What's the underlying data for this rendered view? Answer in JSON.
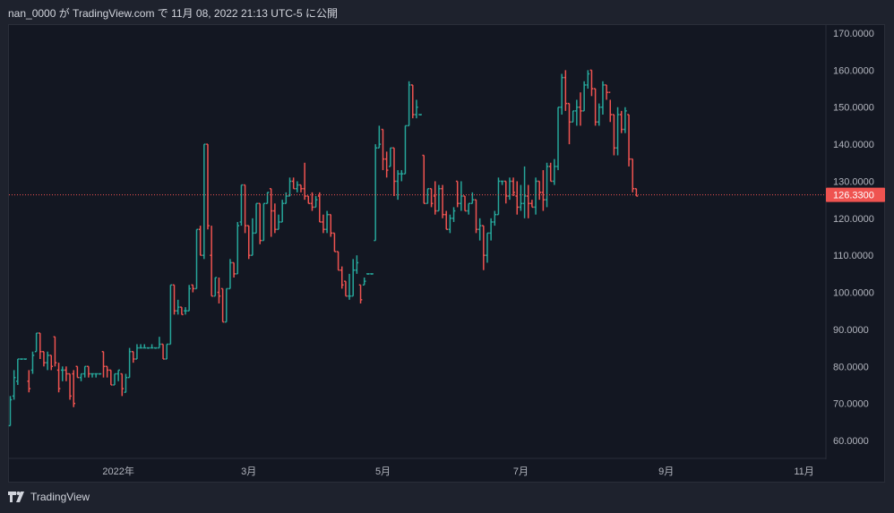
{
  "header": {
    "publish_text": "nan_0000 が TradingView.com で 11月 08, 2022 21:13 UTC-5 に公開"
  },
  "footer": {
    "brand_text": "TradingView",
    "logo_icon": "tradingview-logo-icon"
  },
  "colors": {
    "background": "#131722",
    "outer_background": "#1e222d",
    "up": "#26a69a",
    "down": "#ef5350",
    "text": "#d1d4dc",
    "axis_text": "#b2b5be",
    "price_line": "#ef5350"
  },
  "chart_data": {
    "type": "ohlc",
    "title": "",
    "xlabel": "",
    "ylabel": "",
    "ylim": [
      55,
      172
    ],
    "y_ticks": [
      "60.0000",
      "70.0000",
      "80.0000",
      "90.0000",
      "100.0000",
      "110.0000",
      "120.0000",
      "130.0000",
      "140.0000",
      "150.0000",
      "160.0000",
      "170.0000"
    ],
    "y_tick_values": [
      60,
      70,
      80,
      90,
      100,
      110,
      120,
      130,
      140,
      150,
      160,
      170
    ],
    "x_ticks": [
      "2022年",
      "3月",
      "5月",
      "7月",
      "9月",
      "11月"
    ],
    "x_tick_bar_index": [
      29,
      64,
      100,
      137,
      176,
      213
    ],
    "last_price": 126.33,
    "last_price_label": "126.3300",
    "series": [
      {
        "bars": [
          [
            64,
            72,
            64,
            71
          ],
          [
            72,
            79,
            71,
            77
          ],
          [
            76,
            82,
            75,
            82
          ],
          [
            82,
            82,
            82,
            82
          ],
          [
            82,
            82,
            82,
            82
          ],
          [
            76,
            79,
            73,
            74
          ],
          [
            79,
            84,
            78,
            83
          ],
          [
            84,
            89,
            84,
            89
          ],
          [
            89,
            89,
            82,
            84
          ],
          [
            84,
            84,
            80,
            81
          ],
          [
            81,
            84,
            79,
            83
          ],
          [
            83,
            83,
            79,
            80
          ],
          [
            88,
            88,
            80,
            81
          ],
          [
            79,
            81,
            73,
            74
          ],
          [
            79,
            80,
            76,
            79
          ],
          [
            79,
            80,
            76,
            78
          ],
          [
            78,
            78,
            71,
            72
          ],
          [
            78,
            79,
            69,
            70
          ],
          [
            80,
            80,
            77,
            77
          ],
          [
            77,
            78,
            76,
            78
          ],
          [
            78,
            80,
            77,
            80
          ],
          [
            80,
            80,
            77,
            78
          ],
          [
            78,
            78,
            77,
            78
          ],
          [
            78,
            78,
            77,
            78
          ],
          [
            78,
            78,
            78,
            78
          ],
          [
            84,
            84,
            77,
            80
          ],
          [
            80,
            80,
            77,
            79
          ],
          [
            79,
            79,
            75,
            75
          ],
          [
            75,
            78,
            75,
            78
          ],
          [
            78,
            79,
            76,
            79
          ],
          [
            78,
            78,
            72,
            74
          ],
          [
            73,
            78,
            73,
            77
          ],
          [
            77,
            85,
            77,
            84
          ],
          [
            84,
            84,
            81,
            82
          ],
          [
            82,
            86,
            82,
            85
          ],
          [
            85,
            86,
            85,
            85
          ],
          [
            85,
            86,
            85,
            85
          ],
          [
            85,
            85,
            85,
            85
          ],
          [
            85,
            86,
            85,
            85
          ],
          [
            85,
            85,
            85,
            85
          ],
          [
            85,
            88,
            85,
            86
          ],
          [
            86,
            86,
            82,
            82
          ],
          [
            82,
            86,
            82,
            86
          ],
          [
            86,
            102,
            86,
            102
          ],
          [
            102,
            102,
            94,
            95
          ],
          [
            95,
            98,
            94,
            96
          ],
          [
            96,
            96,
            94,
            94
          ],
          [
            95,
            96,
            94,
            95
          ],
          [
            95,
            102,
            95,
            101
          ],
          [
            102,
            102,
            100,
            101
          ],
          [
            101,
            117,
            101,
            117
          ],
          [
            117,
            118,
            110,
            110
          ],
          [
            110,
            140,
            109,
            140
          ],
          [
            140,
            140,
            117,
            118
          ],
          [
            110,
            118,
            99,
            99
          ],
          [
            99,
            104,
            99,
            104
          ],
          [
            100,
            104,
            97,
            99
          ],
          [
            101,
            101,
            92,
            92
          ],
          [
            92,
            101,
            92,
            101
          ],
          [
            101,
            109,
            101,
            108
          ],
          [
            108,
            108,
            104,
            105
          ],
          [
            105,
            119,
            105,
            118
          ],
          [
            119,
            129,
            118,
            129
          ],
          [
            129,
            129,
            116,
            118
          ],
          [
            118,
            118,
            109,
            110
          ],
          [
            110,
            120,
            110,
            116
          ],
          [
            116,
            124,
            116,
            124
          ],
          [
            124,
            124,
            113,
            114
          ],
          [
            114,
            124,
            114,
            124
          ],
          [
            124,
            127,
            124,
            127
          ],
          [
            128,
            128,
            115,
            122
          ],
          [
            122,
            124,
            116,
            117
          ],
          [
            117,
            121,
            117,
            119
          ],
          [
            119,
            125,
            119,
            124
          ],
          [
            124,
            127,
            124,
            126
          ],
          [
            126,
            131,
            126,
            130
          ],
          [
            130,
            131,
            128,
            128
          ],
          [
            128,
            130,
            127,
            129
          ],
          [
            129,
            129,
            127,
            128
          ],
          [
            128,
            135,
            125,
            126
          ],
          [
            126,
            126,
            124,
            124
          ],
          [
            124,
            127,
            122,
            123
          ],
          [
            123,
            126,
            123,
            125
          ],
          [
            126,
            127,
            119,
            119
          ],
          [
            119,
            121,
            116,
            117
          ],
          [
            117,
            122,
            116,
            121
          ],
          [
            121,
            121,
            115,
            116
          ],
          [
            116,
            116,
            111,
            111
          ],
          [
            111,
            111,
            106,
            106
          ],
          [
            106,
            107,
            101,
            102
          ],
          [
            103,
            103,
            99,
            99
          ],
          [
            99,
            105,
            98,
            99
          ],
          [
            99,
            109,
            99,
            106
          ],
          [
            106,
            110,
            105,
            108
          ],
          [
            102,
            102,
            97,
            98
          ],
          [
            102,
            104,
            102,
            103
          ],
          [
            105,
            105,
            105,
            105
          ],
          [
            105,
            105,
            105,
            105
          ],
          [
            114,
            140,
            114,
            139
          ],
          [
            139,
            145,
            139,
            140
          ],
          [
            144,
            144,
            133,
            136
          ],
          [
            136,
            138,
            131,
            133
          ],
          [
            134,
            139,
            134,
            139
          ],
          [
            139,
            139,
            126,
            130
          ],
          [
            130,
            133,
            125,
            132
          ],
          [
            132,
            133,
            130,
            132
          ],
          [
            132,
            145,
            132,
            145
          ],
          [
            145,
            157,
            145,
            156
          ],
          [
            156,
            156,
            147,
            148
          ],
          [
            148,
            152,
            147,
            150
          ],
          [
            148,
            148,
            148,
            148
          ],
          [
            137,
            137,
            124,
            124
          ],
          [
            124,
            128,
            124,
            128
          ],
          [
            128,
            128,
            123,
            124
          ],
          [
            126,
            130,
            121,
            122
          ],
          [
            122,
            129,
            122,
            128
          ],
          [
            128,
            129,
            120,
            121
          ],
          [
            121,
            122,
            117,
            117
          ],
          [
            117,
            121,
            116,
            120
          ],
          [
            120,
            123,
            119,
            122
          ],
          [
            130,
            130,
            123,
            124
          ],
          [
            124,
            130,
            122,
            126
          ],
          [
            126,
            126,
            122,
            122
          ],
          [
            122,
            124,
            121,
            124
          ],
          [
            124,
            127,
            124,
            125
          ],
          [
            125,
            125,
            116,
            117
          ],
          [
            117,
            120,
            114,
            118
          ],
          [
            118,
            118,
            106,
            110
          ],
          [
            110,
            116,
            108,
            116
          ],
          [
            116,
            120,
            114,
            119
          ],
          [
            119,
            122,
            118,
            121
          ],
          [
            121,
            131,
            121,
            130
          ],
          [
            130,
            130,
            129,
            130
          ],
          [
            130,
            130,
            124,
            126
          ],
          [
            126,
            131,
            125,
            130
          ],
          [
            130,
            131,
            126,
            127
          ],
          [
            126,
            130,
            121,
            123
          ],
          [
            123,
            129,
            122,
            124
          ],
          [
            124,
            134,
            120,
            126
          ],
          [
            126,
            129,
            120,
            124
          ],
          [
            124,
            125,
            123,
            123
          ],
          [
            123,
            131,
            121,
            130
          ],
          [
            130,
            130,
            125,
            127
          ],
          [
            127,
            133,
            122,
            125
          ],
          [
            125,
            135,
            123,
            134
          ],
          [
            134,
            135,
            130,
            130
          ],
          [
            130,
            136,
            129,
            134
          ],
          [
            134,
            150,
            133,
            150
          ],
          [
            150,
            159,
            148,
            158
          ],
          [
            158,
            160,
            149,
            151
          ],
          [
            151,
            151,
            140,
            146
          ],
          [
            146,
            149,
            146,
            149
          ],
          [
            149,
            152,
            145,
            150
          ],
          [
            150,
            154,
            145,
            149
          ],
          [
            149,
            157,
            149,
            156
          ],
          [
            156,
            160,
            155,
            159
          ],
          [
            160,
            160,
            153,
            155
          ],
          [
            155,
            155,
            145,
            146
          ],
          [
            146,
            151,
            145,
            150
          ],
          [
            150,
            157,
            148,
            156
          ],
          [
            156,
            156,
            152,
            154
          ],
          [
            154,
            152,
            146,
            148
          ],
          [
            148,
            148,
            137,
            139
          ],
          [
            139,
            150,
            137,
            148
          ],
          [
            148,
            149,
            143,
            144
          ],
          [
            144,
            150,
            143,
            149
          ],
          [
            148,
            148,
            134,
            136
          ],
          [
            136,
            136,
            127,
            128
          ],
          [
            128,
            128,
            126,
            126
          ]
        ]
      }
    ]
  }
}
